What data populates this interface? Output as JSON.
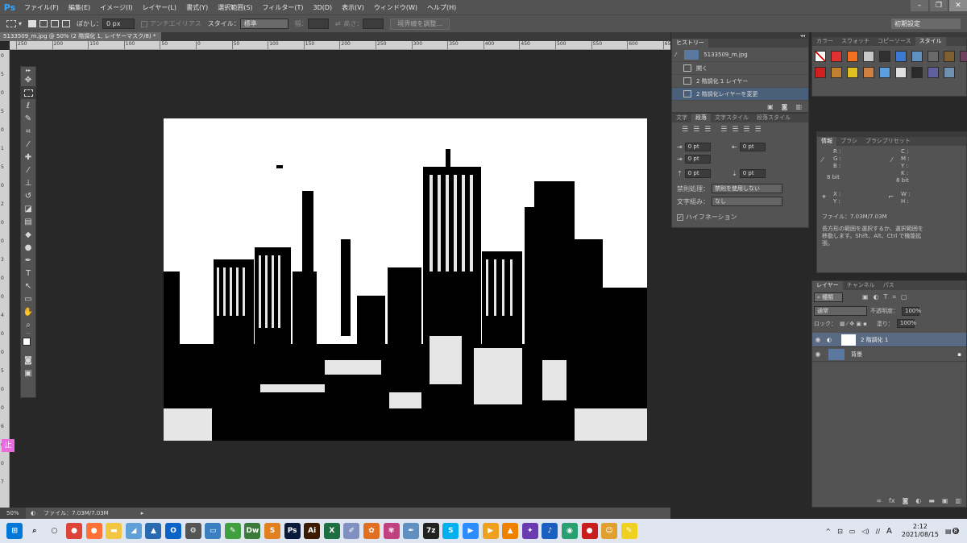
{
  "app": {
    "logo": "Ps"
  },
  "menu": [
    "ファイル(F)",
    "編集(E)",
    "イメージ(I)",
    "レイヤー(L)",
    "書式(Y)",
    "選択範囲(S)",
    "フィルター(T)",
    "3D(D)",
    "表示(V)",
    "ウィンドウ(W)",
    "ヘルプ(H)"
  ],
  "window_controls": {
    "minimize": "–",
    "restore": "❐",
    "close": "✕"
  },
  "options_bar": {
    "feather_label": "ぼかし：",
    "feather_value": "0 px",
    "antialias_label": "アンチエイリアス",
    "style_label": "スタイル：",
    "style_value": "標準",
    "width_label": "幅：",
    "height_label": "高さ：",
    "refine_button": "境界線を調整...",
    "workspace": "初期設定"
  },
  "document": {
    "tab_title": "5133509_m.jpg @ 50% (2 階調化 1, レイヤーマスク/8) *",
    "zoom": "50%",
    "file_info": "ファイル：7.03M/7.03M"
  },
  "ruler": {
    "top": [
      "250",
      "200",
      "150",
      "100",
      "50",
      "0",
      "50",
      "100",
      "150",
      "200",
      "250",
      "300",
      "350",
      "400",
      "450",
      "500",
      "550",
      "600",
      "650"
    ],
    "left": [
      "0",
      "5",
      "0",
      "5",
      "0",
      "1",
      "5",
      "0",
      "2",
      "0",
      "0",
      "3",
      "0",
      "0",
      "4",
      "0",
      "0",
      "5",
      "0",
      "0",
      "6",
      "0",
      "0",
      "7"
    ]
  },
  "history": {
    "tab": "ヒストリー",
    "snapshot": "5133509_m.jpg",
    "items": [
      "開く",
      "2 階調化 1 レイヤー",
      "2 階調化レイヤーを変更"
    ]
  },
  "paragraph": {
    "tabs": [
      "文字",
      "段落",
      "文字スタイル",
      "段落スタイル"
    ],
    "indent_left": "0 pt",
    "indent_right": "0 pt",
    "indent_first": "0 pt",
    "space_before": "0 pt",
    "space_after": "0 pt",
    "kinsoku_label": "禁則処理：",
    "kinsoku_value": "禁則を使用しない",
    "mojikumi_label": "文字組み：",
    "mojikumi_value": "なし",
    "hyphenation": "ハイフネーション"
  },
  "color_panel": {
    "tabs": [
      "カラー",
      "スウォッチ",
      "コピーソース",
      "スタイル"
    ],
    "colors": [
      "#e03030",
      "#f07020",
      "#c8c8c8",
      "#303030",
      "#3a7ad0",
      "#6090c0",
      "#6a6a6a",
      "#806030",
      "#704060",
      "#d02020",
      "#c08030",
      "#e0c020",
      "#d08040",
      "#5aa0e0",
      "#e0e0e0",
      "#2a2a2a",
      "#6060a0",
      "#7090b0"
    ]
  },
  "info_panel": {
    "tabs": [
      "情報",
      "ブラシ",
      "ブラシプリセット"
    ],
    "rgb_labels": [
      "R :",
      "G :",
      "B :"
    ],
    "cmyk_labels": [
      "C :",
      "M :",
      "Y :",
      "K :"
    ],
    "bit_left": "8 bit",
    "bit_right": "8 bit",
    "xy_labels": [
      "X :",
      "Y :"
    ],
    "wh_labels": [
      "W :",
      "H :"
    ],
    "file_info": "ファイル：7.03M/7.03M",
    "hint": "長方形の範囲を選択するか、選択範囲を移動します。Shift、Alt、Ctrl で機能拡張。"
  },
  "layers": {
    "tabs": [
      "レイヤー",
      "チャンネル",
      "パス"
    ],
    "filter_kind": "種類",
    "blend_mode": "通常",
    "opacity_label": "不透明度：",
    "opacity_value": "100%",
    "lock_label": "ロック：",
    "fill_label": "塗り：",
    "fill_value": "100%",
    "items": [
      {
        "name": "2 階調化 1"
      },
      {
        "name": "背景"
      }
    ]
  },
  "taskbar": {
    "icons": [
      {
        "name": "windows",
        "color": "#0078d7",
        "glyph": "⊞"
      },
      {
        "name": "search",
        "color": "#dfe6f0",
        "glyph": "⌕"
      },
      {
        "name": "task-view",
        "color": "#dfe6f0",
        "glyph": "○"
      },
      {
        "name": "chrome",
        "color": "#db4437",
        "glyph": "●"
      },
      {
        "name": "firefox",
        "color": "#ff7139",
        "glyph": "●"
      },
      {
        "name": "explorer",
        "color": "#f3c640",
        "glyph": "▬"
      },
      {
        "name": "app-1",
        "color": "#5fa0d8",
        "glyph": "◢"
      },
      {
        "name": "photos",
        "color": "#2a6ab0",
        "glyph": "▲"
      },
      {
        "name": "outlook",
        "color": "#0a64c8",
        "glyph": "O"
      },
      {
        "name": "settings",
        "color": "#555",
        "glyph": "⚙"
      },
      {
        "name": "app-2",
        "color": "#3a80c0",
        "glyph": "▭"
      },
      {
        "name": "app-3",
        "color": "#40a040",
        "glyph": "✎"
      },
      {
        "name": "dreamweaver",
        "color": "#3a7a3a",
        "glyph": "Dw"
      },
      {
        "name": "app-4",
        "color": "#e08020",
        "glyph": "S"
      },
      {
        "name": "photoshop",
        "color": "#0a1a3a",
        "glyph": "Ps"
      },
      {
        "name": "illustrator",
        "color": "#3a1a00",
        "glyph": "Ai"
      },
      {
        "name": "excel",
        "color": "#1d6f42",
        "glyph": "X"
      },
      {
        "name": "app-5",
        "color": "#8090c0",
        "glyph": "✐"
      },
      {
        "name": "app-6",
        "color": "#e07020",
        "glyph": "✿"
      },
      {
        "name": "app-7",
        "color": "#c04080",
        "glyph": "✾"
      },
      {
        "name": "app-8",
        "color": "#6090c0",
        "glyph": "✒"
      },
      {
        "name": "7zip",
        "color": "#222",
        "glyph": "7z"
      },
      {
        "name": "skype",
        "color": "#00aff0",
        "glyph": "S"
      },
      {
        "name": "zoom",
        "color": "#2d8cff",
        "glyph": "▶"
      },
      {
        "name": "app-9",
        "color": "#f0a020",
        "glyph": "▶"
      },
      {
        "name": "vlc",
        "color": "#f08000",
        "glyph": "▲"
      },
      {
        "name": "app-10",
        "color": "#6a3ab0",
        "glyph": "✦"
      },
      {
        "name": "app-11",
        "color": "#1a60c0",
        "glyph": "♪"
      },
      {
        "name": "app-12",
        "color": "#2aa070",
        "glyph": "◉"
      },
      {
        "name": "record",
        "color": "#c81e1e",
        "glyph": "●"
      },
      {
        "name": "app-13",
        "color": "#e0a030",
        "glyph": "☺"
      },
      {
        "name": "app-14",
        "color": "#f0d020",
        "glyph": "✎"
      }
    ],
    "tray": [
      "^",
      "⊡",
      "▭",
      "◁)",
      "∕∕",
      "A"
    ],
    "time": "2:12",
    "date": "2021/08/15",
    "notifications": "8"
  }
}
